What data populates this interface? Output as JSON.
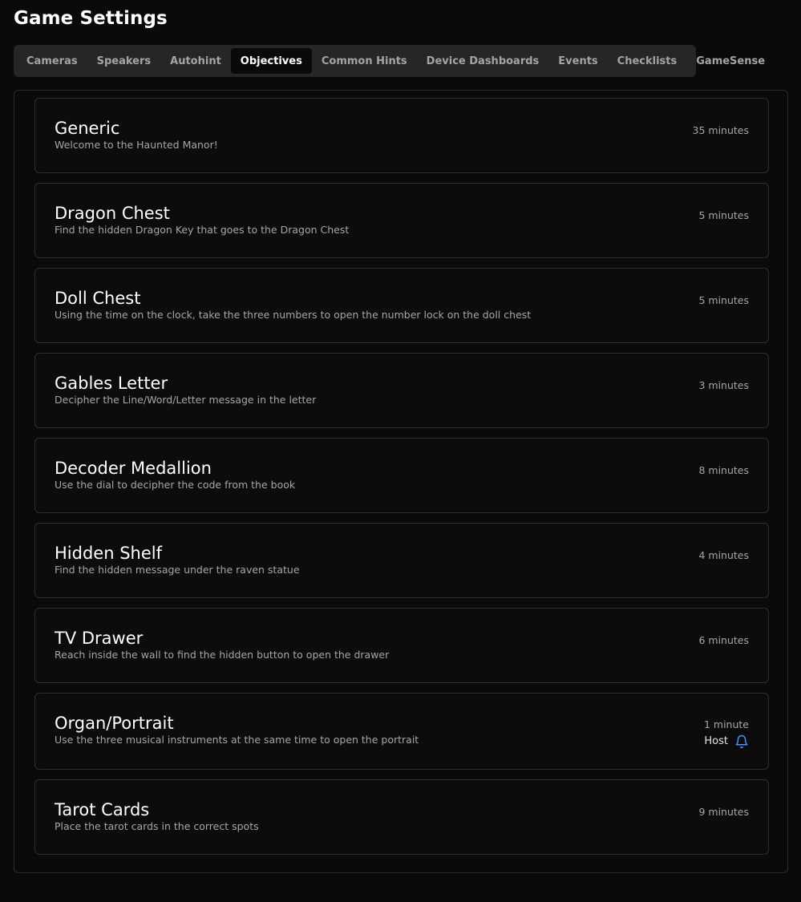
{
  "page": {
    "title": "Game Settings"
  },
  "tabs": [
    {
      "label": "Cameras",
      "active": false
    },
    {
      "label": "Speakers",
      "active": false
    },
    {
      "label": "Autohint",
      "active": false
    },
    {
      "label": "Objectives",
      "active": true
    },
    {
      "label": "Common Hints",
      "active": false
    },
    {
      "label": "Device Dashboards",
      "active": false
    },
    {
      "label": "Events",
      "active": false
    },
    {
      "label": "Checklists",
      "active": false
    },
    {
      "label": "GameSense",
      "active": false
    }
  ],
  "objectives": [
    {
      "title": "Generic",
      "description": "Welcome to the Haunted Manor!",
      "duration": "35 minutes"
    },
    {
      "title": "Dragon Chest",
      "description": "Find the hidden Dragon Key that goes to the Dragon Chest",
      "duration": "5 minutes"
    },
    {
      "title": "Doll Chest",
      "description": "Using the time on the clock, take the three numbers to open the number lock on the doll chest",
      "duration": "5 minutes"
    },
    {
      "title": "Gables Letter",
      "description": "Decipher the Line/Word/Letter message in the letter",
      "duration": "3 minutes"
    },
    {
      "title": "Decoder Medallion",
      "description": "Use the dial to decipher the code from the book",
      "duration": "8 minutes"
    },
    {
      "title": "Hidden Shelf",
      "description": "Find the hidden message under the raven statue",
      "duration": "4 minutes"
    },
    {
      "title": "TV Drawer",
      "description": "Reach inside the wall to find the hidden button to open the drawer",
      "duration": "6 minutes"
    },
    {
      "title": "Organ/Portrait",
      "description": "Use the three musical instruments at the same time to open the portrait",
      "duration": "1 minute",
      "host_label": "Host",
      "host_icon": "bell-icon"
    },
    {
      "title": "Tarot Cards",
      "description": "Place the tarot cards in the correct spots",
      "duration": "9 minutes"
    }
  ],
  "colors": {
    "background": "#0b0a0a",
    "tab_bar": "#262626",
    "card_border": "#2e2e2e",
    "accent_bell": "#4f8ff7"
  }
}
